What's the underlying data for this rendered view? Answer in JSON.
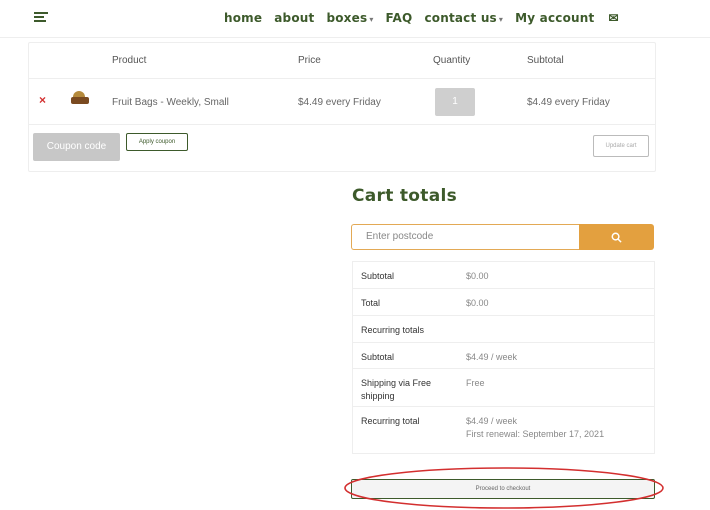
{
  "header": {
    "nav": [
      {
        "label": "home",
        "caret": ""
      },
      {
        "label": "about",
        "caret": ""
      },
      {
        "label": "boxes",
        "caret": "▾"
      },
      {
        "label": "FAQ",
        "caret": ""
      },
      {
        "label": "contact us",
        "caret": "▾"
      },
      {
        "label": "My account",
        "caret": ""
      }
    ],
    "account_icon": "✉"
  },
  "cart": {
    "headers": {
      "product": "Product",
      "price": "Price",
      "quantity": "Quantity",
      "subtotal": "Subtotal"
    },
    "items": [
      {
        "remove": "×",
        "name": "Fruit Bags - Weekly, Small",
        "price": "$4.49 every Friday",
        "quantity": "1",
        "subtotal": "$4.49 every Friday"
      }
    ],
    "coupon_placeholder": "Coupon code",
    "apply_label": "Apply coupon",
    "update_label": "Update cart"
  },
  "totals": {
    "title": "Cart totals",
    "postcode_placeholder": "Enter postcode",
    "search_icon": "search-icon",
    "rows": [
      {
        "key": "Subtotal",
        "value": "$0.00"
      },
      {
        "key": "Total",
        "value": "$0.00"
      },
      {
        "key": "Recurring totals",
        "value": ""
      },
      {
        "key": "Subtotal",
        "value": "$4.49 / week"
      },
      {
        "key": "Shipping via Free shipping",
        "value": "Free"
      },
      {
        "key": "Recurring total",
        "value": "$4.49 / week",
        "note": "First renewal: September 17, 2021"
      }
    ],
    "checkout_label": "Proceed to checkout"
  },
  "colors": {
    "brand_green": "#3d5a2b",
    "accent_orange": "#e3a03f",
    "remove_red": "#d32f2f",
    "annotation_red": "#d32f2f"
  }
}
